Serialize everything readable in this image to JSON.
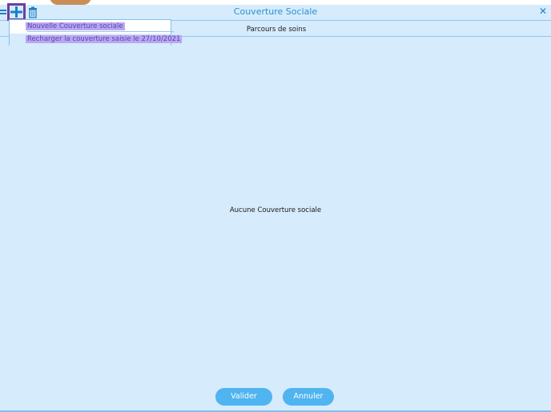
{
  "dialog": {
    "title": "Couverture  Sociale",
    "close_symbol": "✕"
  },
  "toolbar": {
    "list_icon": "list-icon",
    "add_icon": "plus-icon",
    "delete_icon": "trash-icon"
  },
  "menu": {
    "items": [
      {
        "label": "Nouvelle Couverture sociale"
      },
      {
        "label": "Recharger la couverture saisie le 27/10/2021"
      }
    ]
  },
  "section": {
    "label": "Parcours de soins"
  },
  "content": {
    "empty_message": "Aucune Couverture sociale"
  },
  "actions": {
    "validate_label": "Valider",
    "cancel_label": "Annuler"
  },
  "colors": {
    "background": "#d6ebfb",
    "accent": "#2a8fd6",
    "button": "#4fb4ef",
    "highlight": "#b9a8ef",
    "focus_border": "#6b3fa0"
  }
}
